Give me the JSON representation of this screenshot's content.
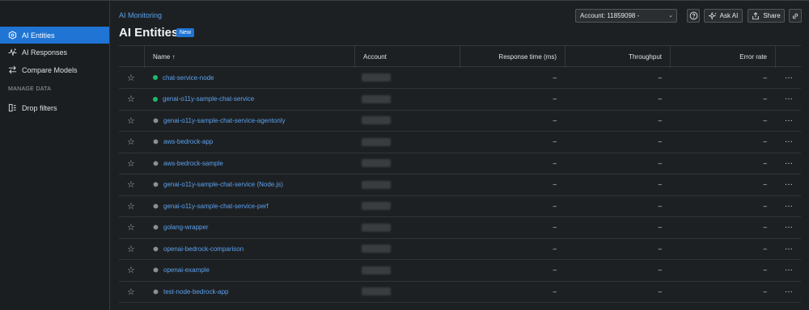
{
  "sidebar": {
    "items": [
      {
        "label": "AI Entities",
        "icon": "hexagon-icon",
        "active": true
      },
      {
        "label": "AI Responses",
        "icon": "pulse-icon",
        "active": false
      },
      {
        "label": "Compare Models",
        "icon": "compare-arrows-icon",
        "active": false
      }
    ],
    "section_label": "MANAGE DATA",
    "manage_items": [
      {
        "label": "Drop filters",
        "icon": "filter-icon"
      }
    ]
  },
  "header": {
    "breadcrumb": "AI Monitoring",
    "title": "AI Entities",
    "badge": "New",
    "account_select": "Account: 11859098 -",
    "ask_ai_label": "Ask AI",
    "share_label": "Share"
  },
  "table": {
    "columns": {
      "name": "Name ↑",
      "account": "Account",
      "response_time": "Response time (ms)",
      "throughput": "Throughput",
      "error_rate": "Error rate"
    },
    "rows": [
      {
        "name": "chat-service-node",
        "status": "green",
        "response_time": "–",
        "throughput": "–",
        "error_rate": "–"
      },
      {
        "name": "genai-o11y-sample-chat-service",
        "status": "green",
        "response_time": "–",
        "throughput": "–",
        "error_rate": "–"
      },
      {
        "name": "genai-o11y-sample-chat-service-agentonly",
        "status": "gray",
        "response_time": "–",
        "throughput": "–",
        "error_rate": "–"
      },
      {
        "name": "aws-bedrock-app",
        "status": "gray",
        "response_time": "–",
        "throughput": "–",
        "error_rate": "–"
      },
      {
        "name": "aws-bedrock-sample",
        "status": "gray",
        "response_time": "–",
        "throughput": "–",
        "error_rate": "–"
      },
      {
        "name": "genai-o11y-sample-chat-service (Node.js)",
        "status": "gray",
        "response_time": "–",
        "throughput": "–",
        "error_rate": "–"
      },
      {
        "name": "genai-o11y-sample-chat-service-perf",
        "status": "gray",
        "response_time": "–",
        "throughput": "–",
        "error_rate": "–"
      },
      {
        "name": "golang-wrapper",
        "status": "gray",
        "response_time": "–",
        "throughput": "–",
        "error_rate": "–"
      },
      {
        "name": "openai-bedrock-comparison",
        "status": "gray",
        "response_time": "–",
        "throughput": "–",
        "error_rate": "–"
      },
      {
        "name": "openai-example",
        "status": "gray",
        "response_time": "–",
        "throughput": "–",
        "error_rate": "–"
      },
      {
        "name": "test-node-bedrock-app",
        "status": "gray",
        "response_time": "–",
        "throughput": "–",
        "error_rate": "–"
      }
    ]
  },
  "colors": {
    "accent": "#1f74d4",
    "link": "#5aa1f0",
    "status_green": "#1fb96b",
    "status_gray": "#8a9094"
  }
}
